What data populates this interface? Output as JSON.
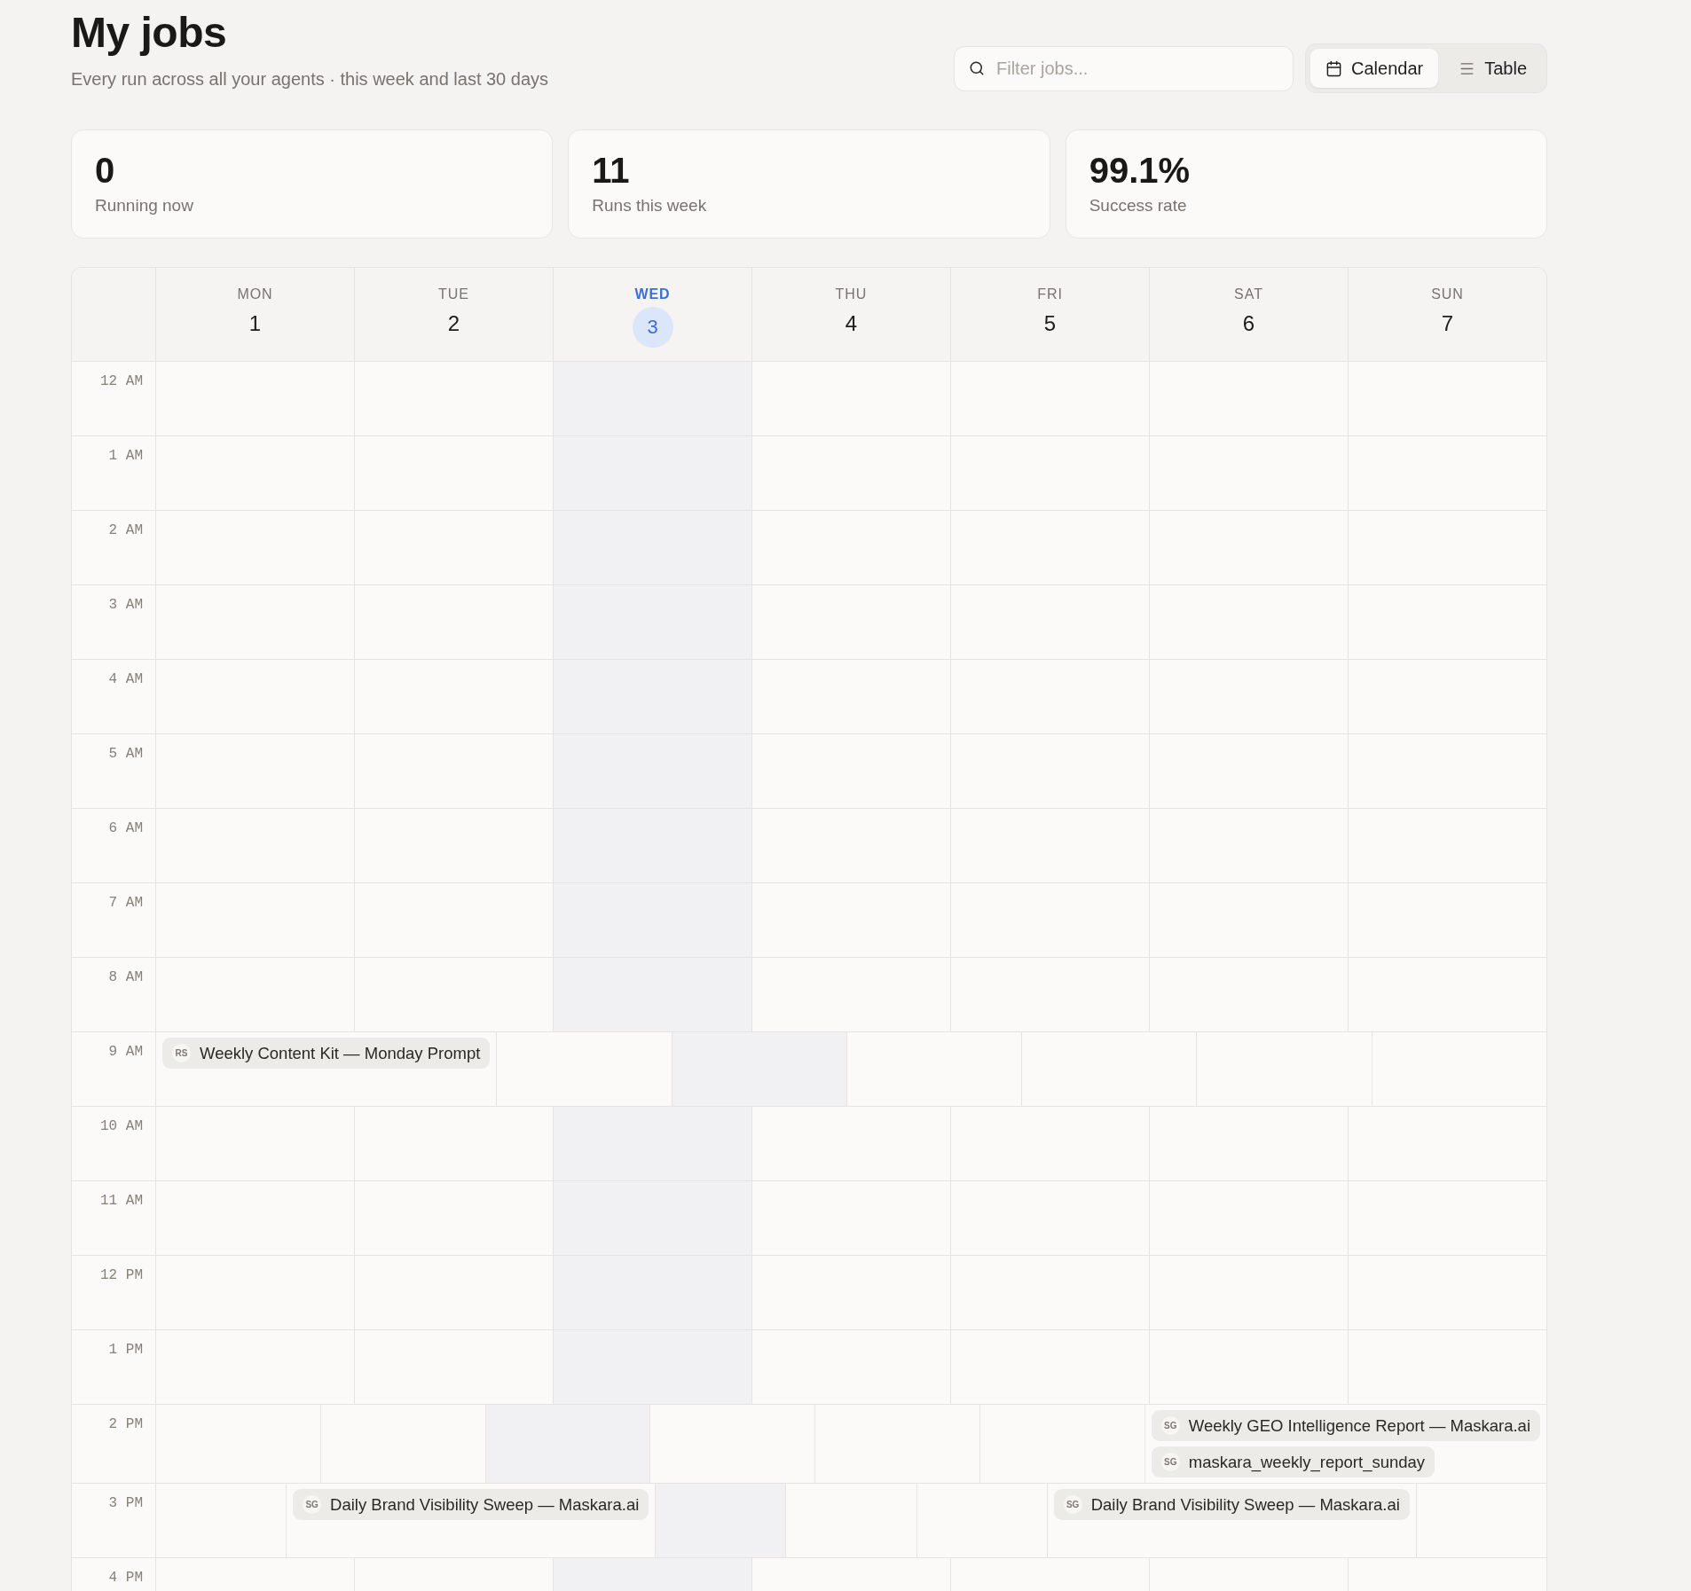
{
  "header": {
    "title": "My jobs",
    "subtitle": "Every run across all your agents · this week and last 30 days"
  },
  "search": {
    "placeholder": "Filter jobs..."
  },
  "view_toggle": [
    {
      "label": "Calendar",
      "kind": "calendar",
      "selected": true
    },
    {
      "label": "Table",
      "kind": "list",
      "selected": false
    }
  ],
  "stats": [
    {
      "value": "0",
      "label": "Running now"
    },
    {
      "value": "11",
      "label": "Runs this week"
    },
    {
      "value": "99.1%",
      "label": "Success rate"
    }
  ],
  "calendar": {
    "days": [
      {
        "weekday": "MON",
        "date": "1",
        "today": false
      },
      {
        "weekday": "TUE",
        "date": "2",
        "today": false
      },
      {
        "weekday": "WED",
        "date": "3",
        "today": true
      },
      {
        "weekday": "THU",
        "date": "4",
        "today": false
      },
      {
        "weekday": "FRI",
        "date": "5",
        "today": false
      },
      {
        "weekday": "SAT",
        "date": "6",
        "today": false
      },
      {
        "weekday": "SUN",
        "date": "7",
        "today": false
      }
    ],
    "hours": [
      {
        "label": "12 AM"
      },
      {
        "label": "1 AM"
      },
      {
        "label": "2 AM"
      },
      {
        "label": "3 AM"
      },
      {
        "label": "4 AM"
      },
      {
        "label": "5 AM"
      },
      {
        "label": "6 AM"
      },
      {
        "label": "7 AM"
      },
      {
        "label": "8 AM"
      },
      {
        "label": "9 AM",
        "cells": [
          {
            "events": [
              {
                "initials": "RS",
                "title": "Weekly Content Kit — Monday Prompt"
              }
            ]
          },
          {},
          {},
          {},
          {},
          {},
          {}
        ]
      },
      {
        "label": "10 AM"
      },
      {
        "label": "11 AM"
      },
      {
        "label": "12 PM"
      },
      {
        "label": "1 PM"
      },
      {
        "label": "2 PM",
        "cells": [
          {},
          {},
          {},
          {},
          {},
          {},
          {
            "events": [
              {
                "initials": "SG",
                "title": "Weekly GEO Intelligence Report — Maskara.ai"
              },
              {
                "initials": "SG",
                "title": "maskara_weekly_report_sunday"
              }
            ]
          }
        ]
      },
      {
        "label": "3 PM",
        "cells": [
          {},
          {
            "events": [
              {
                "initials": "SG",
                "title": "Daily Brand Visibility Sweep — Maskara.ai"
              }
            ]
          },
          {},
          {},
          {},
          {
            "events": [
              {
                "initials": "SG",
                "title": "Daily Brand Visibility Sweep — Maskara.ai"
              }
            ]
          },
          {}
        ]
      },
      {
        "label": "4 PM"
      }
    ]
  }
}
